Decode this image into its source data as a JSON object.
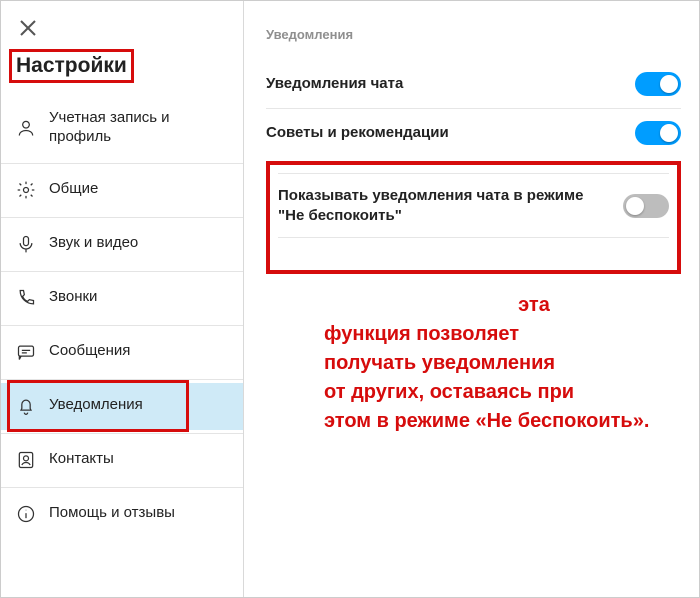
{
  "sidebar": {
    "title": "Настройки",
    "items": [
      {
        "label": "Учетная запись и профиль"
      },
      {
        "label": "Общие"
      },
      {
        "label": "Звук и видео"
      },
      {
        "label": "Звонки"
      },
      {
        "label": "Сообщения"
      },
      {
        "label": "Уведомления"
      },
      {
        "label": "Контакты"
      },
      {
        "label": "Помощь и отзывы"
      }
    ]
  },
  "main": {
    "section_title": "Уведомления",
    "settings": {
      "chat_notifications": {
        "label": "Уведомления чата",
        "value": true
      },
      "tips": {
        "label": "Советы и рекомендации",
        "value": true
      },
      "dnd_notifications": {
        "label": "Показывать уведомления чата в режиме \"Не беспокоить\"",
        "value": false
      }
    }
  },
  "annotation": {
    "line1": "эта",
    "line2": "функция позволяет",
    "line3": "получать уведомления",
    "line4": "от других, оставаясь при",
    "line5": "этом в режиме «Не беспокоить»."
  }
}
